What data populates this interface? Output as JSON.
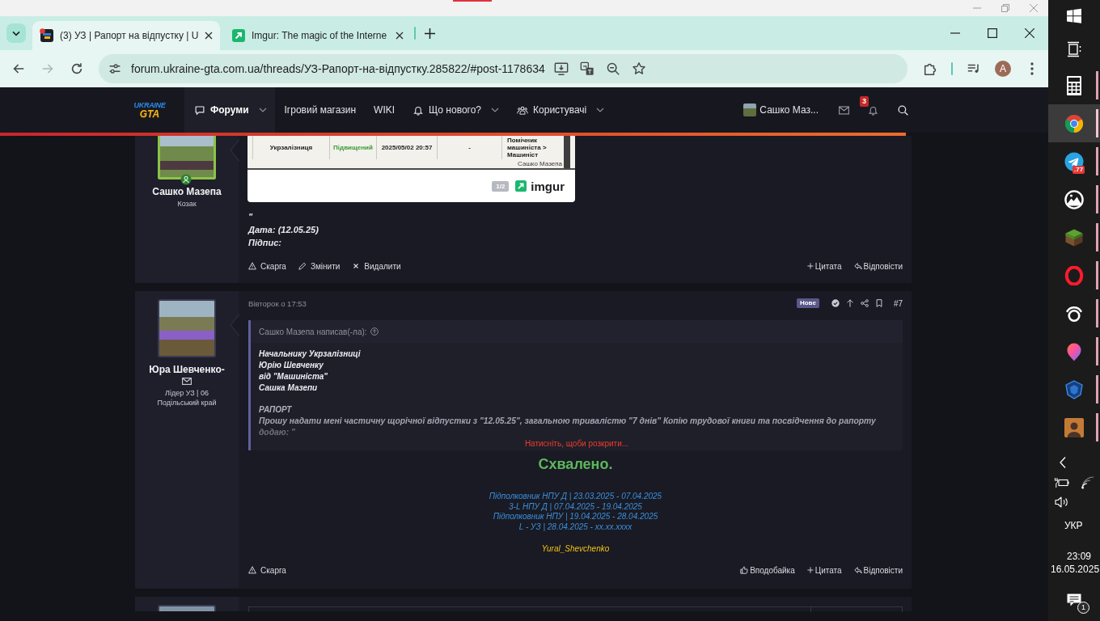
{
  "browser": {
    "tabs": [
      {
        "title": "(3) УЗ | Рапорт на відпустку | U",
        "kind": "forum",
        "unread": true,
        "selected": true
      },
      {
        "title": "Imgur: The magic of the Interne",
        "kind": "image-host",
        "unread": false,
        "selected": false
      }
    ],
    "url": "forum.ukraine-gta.com.ua/threads/УЗ-Рапорт-на-відпустку.285822/#post-1178634",
    "back_enabled": true,
    "forward_enabled": false,
    "profile_initial": "A"
  },
  "nav": {
    "logo": [
      "UKRAINE",
      "GTA"
    ],
    "items": [
      {
        "label": "Форуми",
        "kind": "chat",
        "dropdown": true,
        "selected": true
      },
      {
        "label": "Ігровий магазин",
        "kind": "link",
        "dropdown": false,
        "selected": false
      },
      {
        "label": "WIKI",
        "kind": "link",
        "dropdown": false,
        "selected": false
      },
      {
        "label": "Що нового?",
        "kind": "bell",
        "dropdown": true,
        "selected": false
      },
      {
        "label": "Користувачі",
        "kind": "users",
        "dropdown": true,
        "selected": false
      }
    ],
    "user": "Сашко Маз...",
    "alerts": "3"
  },
  "posts": [
    {
      "author": {
        "name": "Сашко Мазепа",
        "title": "Козак",
        "online": true,
        "can_message": false
      },
      "embed": {
        "cells": [
          {
            "text": "Укрзалізниця"
          },
          {
            "text": "Підвищений",
            "color": "#3d9b35"
          },
          {
            "text": "2025/05/02 20:57"
          },
          {
            "text": "-"
          },
          {
            "text": "Помічник машиніста > Машиніст"
          }
        ],
        "credit": "Сашко Мазепа",
        "counter": "1/2",
        "brand": "imgur"
      },
      "body": [
        "\"",
        "Дата: (12.05.25)",
        "Підпис:"
      ],
      "actions_left": [
        {
          "kind": "warning",
          "label": "Скарга"
        },
        {
          "kind": "pencil",
          "label": "Змінити"
        },
        {
          "kind": "cross",
          "label": "Видалити"
        }
      ],
      "actions_right": [
        {
          "kind": "plus",
          "label": "Цитата"
        },
        {
          "kind": "reply",
          "label": "Відповісти"
        }
      ]
    },
    {
      "author": {
        "name": "Юра Шевченко-",
        "title": "Лідер УЗ | 06",
        "region": "Подільський край",
        "online": false,
        "can_message": true
      },
      "date": "Вівторок о 17:53",
      "badge": "Нове",
      "number": "#7",
      "quote": {
        "header": "Сашко Мазепа написав(-ла):",
        "lines": [
          "Начальнику Укрзалізниці",
          "Юрію Шевченку",
          "від \"Машиніста\"",
          "Сашка Мазепи"
        ],
        "heading": "РАПОРТ",
        "paragraph": "Прошу надати мені частичну щорічної відпустки з \"12.05.25\", загальною тривалістю \"7 днів\" Копію трудової книги та посвідчення до рапорту додаю: \"",
        "expand": "Натисніть, щоби розкрити..."
      },
      "verdict": "Схвалено.",
      "ranks": [
        "Підполковник НПУ Д | 23.03.2025 - 07.04.2025",
        "3-L НПУ Д | 07.04.2025 - 19.04.2025",
        "Підполковник НПУ | 19.04.2025 - 28.04.2025",
        "L - УЗ | 28.04.2025 - xx.xx.xxxx"
      ],
      "signature": "Yural_Shevchenko",
      "actions_left": [
        {
          "kind": "warning",
          "label": "Скарга"
        }
      ],
      "actions_right": [
        {
          "kind": "thumb",
          "label": "Вподобайка"
        },
        {
          "kind": "plus",
          "label": "Цитата"
        },
        {
          "kind": "reply",
          "label": "Відповісти"
        }
      ]
    }
  ],
  "taskbar": {
    "apps": [
      {
        "kind": "start",
        "running": false,
        "selected": false
      },
      {
        "kind": "task-view",
        "running": false,
        "selected": false
      },
      {
        "kind": "calculator",
        "running": true,
        "selected": false
      },
      {
        "kind": "chrome",
        "running": true,
        "selected": true
      },
      {
        "kind": "telegram",
        "running": true,
        "selected": false,
        "badge": ".77"
      },
      {
        "kind": "mountain",
        "running": true,
        "selected": false
      },
      {
        "kind": "grass-block",
        "running": true,
        "selected": false
      },
      {
        "kind": "opera",
        "running": true,
        "selected": false
      },
      {
        "kind": "ring",
        "running": true,
        "selected": false
      },
      {
        "kind": "paint",
        "running": true,
        "selected": false
      },
      {
        "kind": "emblem",
        "running": true,
        "selected": false
      },
      {
        "kind": "portrait",
        "running": true,
        "selected": false
      }
    ],
    "language": "УКР",
    "time": "23:09",
    "date": "16.05.2025",
    "notifications": "1"
  }
}
